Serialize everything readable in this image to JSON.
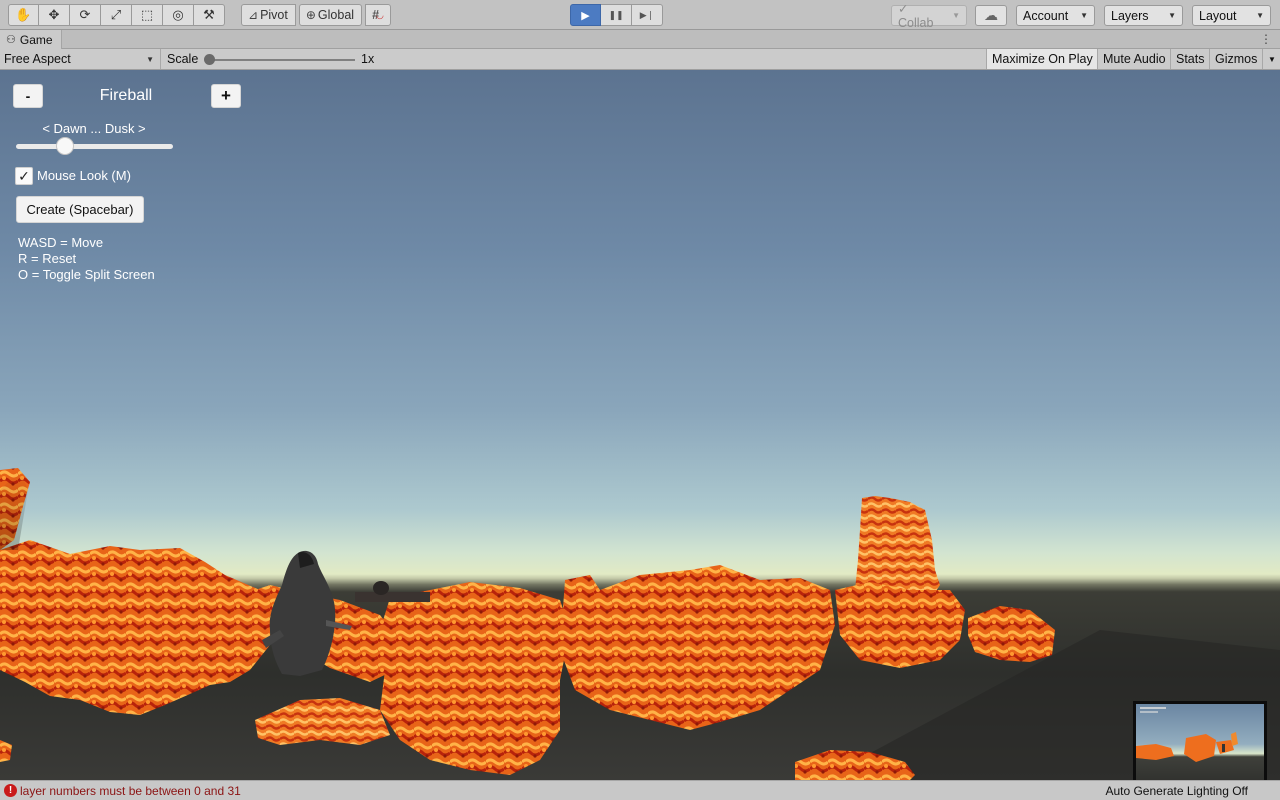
{
  "toolbar": {
    "tools": [
      {
        "name": "hand-tool",
        "glyph": "✋"
      },
      {
        "name": "move-tool",
        "glyph": "✥"
      },
      {
        "name": "rotate-tool",
        "glyph": "⟳"
      },
      {
        "name": "scale-tool",
        "glyph": "⤢"
      },
      {
        "name": "rect-tool",
        "glyph": "⬚"
      },
      {
        "name": "transform-tool",
        "glyph": "◎"
      },
      {
        "name": "custom-tool",
        "glyph": "⚒"
      }
    ],
    "pivot_label": "Pivot",
    "global_label": "Global",
    "grid_snap_glyph": "#",
    "play_glyph": "▶",
    "pause_glyph": "❚❚",
    "step_glyph": "▶❘",
    "collab_label": "Collab",
    "cloud_glyph": "☁",
    "account_label": "Account",
    "layers_label": "Layers",
    "layout_label": "Layout"
  },
  "tab": {
    "game_label": "Game",
    "game_icon": "⚇",
    "menu_glyph": "⋮"
  },
  "game_view": {
    "aspect_label": "Free Aspect",
    "scale_label": "Scale",
    "scale_value": "1x",
    "maximize_label": "Maximize On Play",
    "mute_label": "Mute Audio",
    "stats_label": "Stats",
    "gizmos_label": "Gizmos",
    "dropdown_arrow": "▼"
  },
  "overlay": {
    "minus_label": "-",
    "effect_name": "Fireball",
    "plus_label": "+",
    "time_of_day_label": "< Dawn ... Dusk >",
    "time_of_day_value": 0.29,
    "mouse_look_label": "Mouse Look (M)",
    "mouse_look_checked": true,
    "check_glyph": "✓",
    "create_label": "Create (Spacebar)",
    "help_lines": [
      "WASD = Move",
      "R = Reset",
      "O = Toggle Split Screen"
    ]
  },
  "status": {
    "error_icon": "!",
    "error_text": "layer numbers must be between 0 and 31",
    "right_text": "Auto Generate Lighting Off"
  },
  "colors": {
    "play_active": "#4c7bc2",
    "fire_bright": "#ff8a2a",
    "fire_dark": "#c2280c",
    "error": "#c91a1a"
  }
}
